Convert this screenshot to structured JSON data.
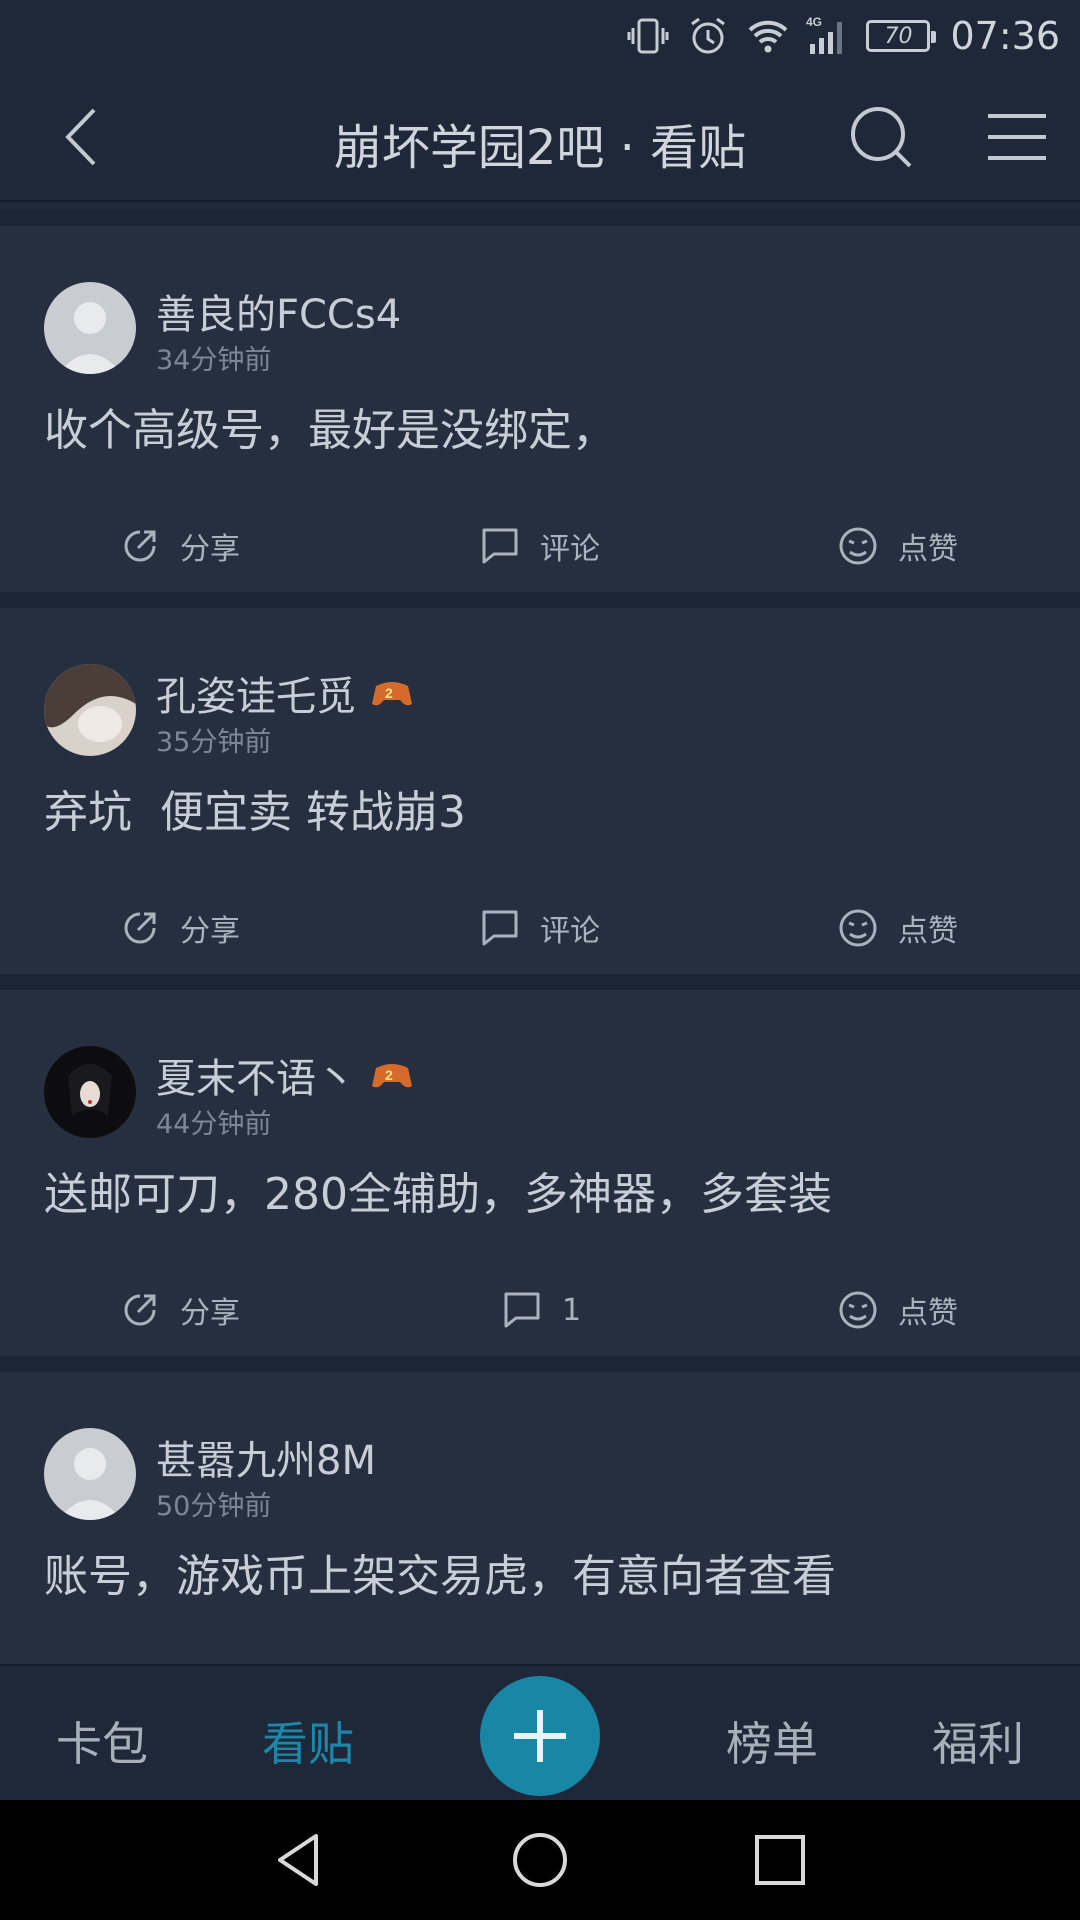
{
  "status_bar": {
    "icons": [
      "vibrate-icon",
      "alarm-icon",
      "wifi-icon",
      "signal-4g-icon"
    ],
    "network_label": "4G",
    "battery": "70",
    "time": "07:36"
  },
  "header": {
    "title": "崩坏学园2吧 · 看贴",
    "back_icon": "chevron-left-icon",
    "search_icon": "search-icon",
    "menu_icon": "menu-icon"
  },
  "posts": [
    {
      "username": "善良的FCCs4",
      "has_badge": false,
      "time": "34分钟前",
      "text": "收个高级号，最好是没绑定，",
      "share_label": "分享",
      "comment_label": "评论",
      "like_label": "点赞"
    },
    {
      "username": "孔姿诖乇觅",
      "has_badge": true,
      "time": "35分钟前",
      "text": "弃坑  便宜卖 转战崩3",
      "share_label": "分享",
      "comment_label": "评论",
      "like_label": "点赞"
    },
    {
      "username": "夏末不语丶",
      "has_badge": true,
      "time": "44分钟前",
      "text": "送邮可刀，280全辅助，多神器，多套装",
      "share_label": "分享",
      "comment_label": "1",
      "like_label": "点赞"
    },
    {
      "username": "甚嚣九州8M",
      "has_badge": false,
      "time": "50分钟前",
      "text": "账号，游戏币上架交易虎，有意向者查看",
      "share_label": "分享",
      "comment_label": "评论",
      "like_label": "点赞"
    }
  ],
  "tabbar": {
    "tab1": "卡包",
    "tab2": "看贴",
    "tab3": "榜单",
    "tab4": "福利",
    "active_color": "#1e86a8",
    "fab_icon": "plus-icon"
  },
  "navbar": {
    "icons": [
      "nav-back-icon",
      "nav-home-icon",
      "nav-recent-icon"
    ]
  }
}
